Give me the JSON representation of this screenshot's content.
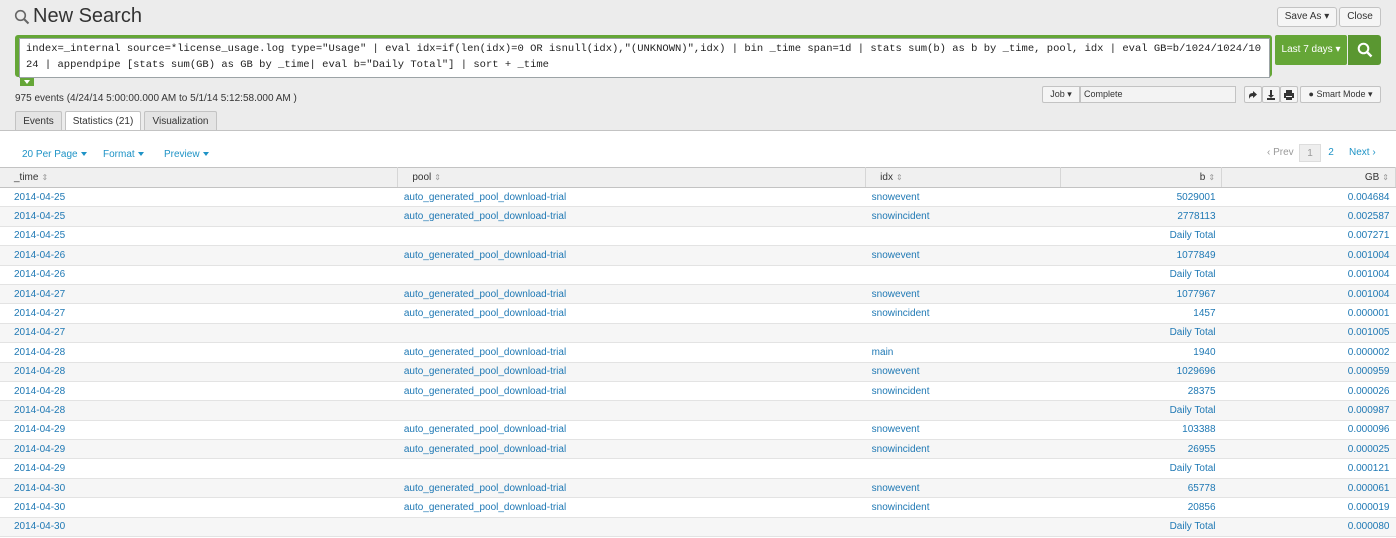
{
  "header": {
    "title": "New Search",
    "save_as_label": "Save As",
    "close_label": "Close"
  },
  "search": {
    "query": "index=_internal source=*license_usage.log type=\"Usage\" | eval idx=if(len(idx)=0 OR isnull(idx),\"(UNKNOWN)\",idx) | bin _time span=1d | stats sum(b) as b by _time, pool, idx | eval GB=b/1024/1024/1024 | appendpipe [stats sum(GB) as GB by _time| eval b=\"Daily Total\"] | sort + _time",
    "time_range_label": "Last 7 days"
  },
  "status": {
    "event_count": "975 events (4/24/14 5:00:00.000 AM to 5/1/14 5:12:58.000 AM )",
    "job_label": "Job",
    "job_status": "Complete",
    "mode_label": "Smart Mode"
  },
  "tabs": [
    {
      "label": "Events"
    },
    {
      "label": "Statistics (21)"
    },
    {
      "label": "Visualization"
    }
  ],
  "toolbar": {
    "per_page_label": "20 Per Page",
    "format_label": "Format",
    "preview_label": "Preview"
  },
  "pagination": {
    "prev_label": "‹ Prev",
    "page1": "1",
    "page2": "2",
    "next_label": "Next ›"
  },
  "table": {
    "columns": [
      "_time",
      "pool",
      "idx",
      "b",
      "GB"
    ],
    "rows": [
      [
        "2014-04-25",
        "auto_generated_pool_download-trial",
        "snowevent",
        "5029001",
        "0.004684"
      ],
      [
        "2014-04-25",
        "auto_generated_pool_download-trial",
        "snowincident",
        "2778113",
        "0.002587"
      ],
      [
        "2014-04-25",
        "",
        "",
        "Daily Total",
        "0.007271"
      ],
      [
        "2014-04-26",
        "auto_generated_pool_download-trial",
        "snowevent",
        "1077849",
        "0.001004"
      ],
      [
        "2014-04-26",
        "",
        "",
        "Daily Total",
        "0.001004"
      ],
      [
        "2014-04-27",
        "auto_generated_pool_download-trial",
        "snowevent",
        "1077967",
        "0.001004"
      ],
      [
        "2014-04-27",
        "auto_generated_pool_download-trial",
        "snowincident",
        "1457",
        "0.000001"
      ],
      [
        "2014-04-27",
        "",
        "",
        "Daily Total",
        "0.001005"
      ],
      [
        "2014-04-28",
        "auto_generated_pool_download-trial",
        "main",
        "1940",
        "0.000002"
      ],
      [
        "2014-04-28",
        "auto_generated_pool_download-trial",
        "snowevent",
        "1029696",
        "0.000959"
      ],
      [
        "2014-04-28",
        "auto_generated_pool_download-trial",
        "snowincident",
        "28375",
        "0.000026"
      ],
      [
        "2014-04-28",
        "",
        "",
        "Daily Total",
        "0.000987"
      ],
      [
        "2014-04-29",
        "auto_generated_pool_download-trial",
        "snowevent",
        "103388",
        "0.000096"
      ],
      [
        "2014-04-29",
        "auto_generated_pool_download-trial",
        "snowincident",
        "26955",
        "0.000025"
      ],
      [
        "2014-04-29",
        "",
        "",
        "Daily Total",
        "0.000121"
      ],
      [
        "2014-04-30",
        "auto_generated_pool_download-trial",
        "snowevent",
        "65778",
        "0.000061"
      ],
      [
        "2014-04-30",
        "auto_generated_pool_download-trial",
        "snowincident",
        "20856",
        "0.000019"
      ],
      [
        "2014-04-30",
        "",
        "",
        "Daily Total",
        "0.000080"
      ]
    ]
  },
  "colors": {
    "accent_green": "#65a637",
    "link_blue": "#1e78b4"
  }
}
